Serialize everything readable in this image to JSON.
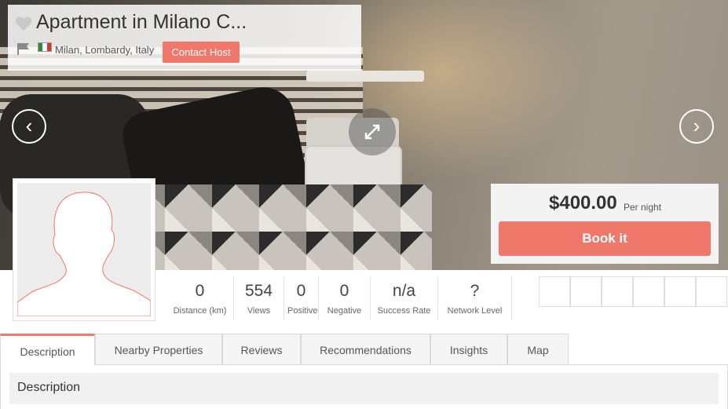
{
  "listing": {
    "title": "Apartment in Milano C...",
    "location": "Milan, Lombardy, Italy",
    "contact_label": "Contact Host"
  },
  "gallery": {
    "prev_label": "‹",
    "next_label": "›"
  },
  "booking": {
    "price": "$400.00",
    "per": "Per night",
    "book_label": "Book it"
  },
  "stats": [
    {
      "value": "0",
      "label": "Distance (km)"
    },
    {
      "value": "554",
      "label": "Views"
    },
    {
      "value": "0",
      "label": "Positive"
    },
    {
      "value": "0",
      "label": "Negative"
    },
    {
      "value": "n/a",
      "label": "Success Rate"
    },
    {
      "value": "?",
      "label": "Network Level"
    }
  ],
  "tabs": [
    {
      "label": "Description",
      "active": true
    },
    {
      "label": "Nearby Properties"
    },
    {
      "label": "Reviews"
    },
    {
      "label": "Recommendations"
    },
    {
      "label": "Insights"
    },
    {
      "label": "Map"
    }
  ],
  "section": {
    "title": "Description"
  },
  "colors": {
    "accent": "#f0786a",
    "flag_green": "#2f8a3c",
    "flag_white": "#ffffff",
    "flag_red": "#d23a2d"
  },
  "icons": {
    "favorite": "heart-icon",
    "report": "flag-icon",
    "expand": "expand-icon"
  }
}
